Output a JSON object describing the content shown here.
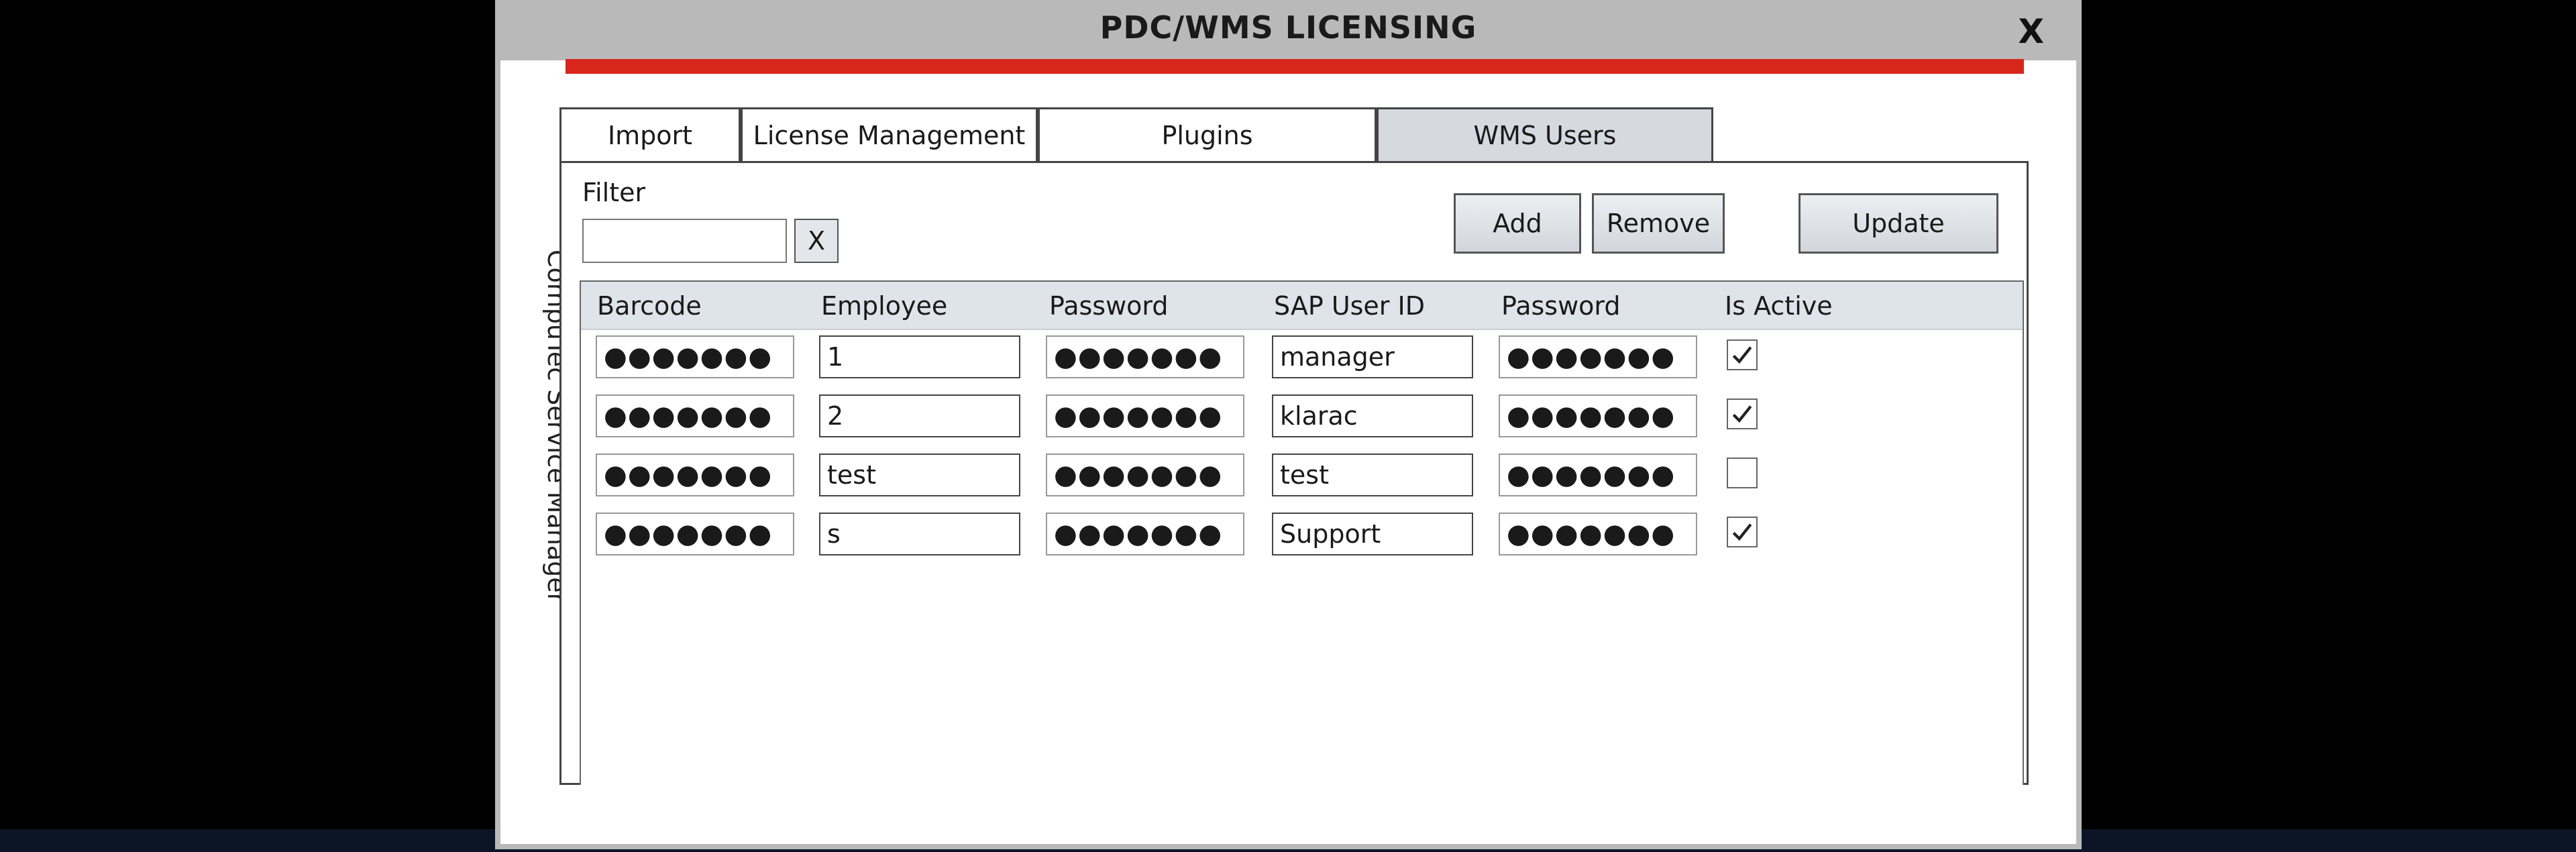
{
  "window": {
    "title": "PDC/WMS LICENSING",
    "close_label": "X"
  },
  "side_label": "CompuTec Service Manager",
  "tabs": [
    {
      "label": "Import",
      "active": false
    },
    {
      "label": "License Management",
      "active": false
    },
    {
      "label": "Plugins",
      "active": false
    },
    {
      "label": "WMS Users",
      "active": true
    }
  ],
  "filter": {
    "label": "Filter",
    "value": "",
    "clear_label": "X"
  },
  "buttons": {
    "add": "Add",
    "remove": "Remove",
    "update": "Update"
  },
  "table": {
    "columns": [
      "Barcode",
      "Employee",
      "Password",
      "SAP User ID",
      "Password",
      "Is Active"
    ],
    "rows": [
      {
        "barcode": "●●●●●●●",
        "employee": "1",
        "password": "●●●●●●●",
        "sap_user_id": "manager",
        "sap_password": "●●●●●●●",
        "is_active": true
      },
      {
        "barcode": "●●●●●●●",
        "employee": "2",
        "password": "●●●●●●●",
        "sap_user_id": "klarac",
        "sap_password": "●●●●●●●",
        "is_active": true
      },
      {
        "barcode": "●●●●●●●",
        "employee": "test",
        "password": "●●●●●●●",
        "sap_user_id": "test",
        "sap_password": "●●●●●●●",
        "is_active": false
      },
      {
        "barcode": "●●●●●●●",
        "employee": "s",
        "password": "●●●●●●●",
        "sap_user_id": "Support",
        "sap_password": "●●●●●●●",
        "is_active": true
      }
    ]
  },
  "colors": {
    "accent_red": "#d9261c",
    "titlebar": "#b9b9b9",
    "active_tab": "#d6d9df"
  }
}
